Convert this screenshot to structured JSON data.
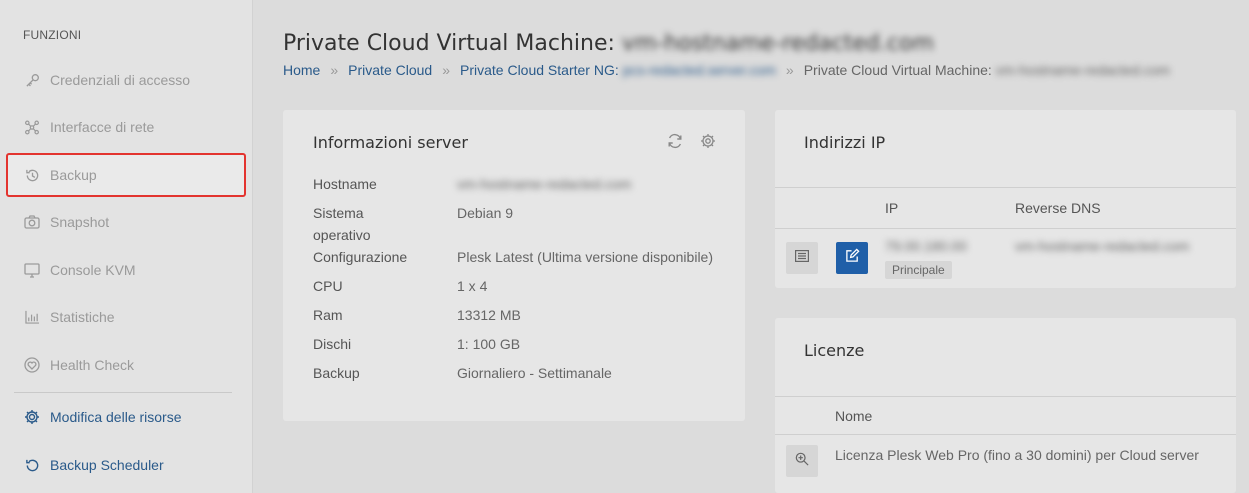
{
  "sidebar": {
    "heading": "FUNZIONI",
    "items": [
      {
        "label": "Credenziali di accesso",
        "icon": "key-icon"
      },
      {
        "label": "Interfacce di rete",
        "icon": "network-icon"
      },
      {
        "label": "Backup",
        "icon": "history-icon"
      },
      {
        "label": "Snapshot",
        "icon": "camera-icon"
      },
      {
        "label": "Console KVM",
        "icon": "monitor-icon"
      },
      {
        "label": "Statistiche",
        "icon": "bar-chart-icon"
      },
      {
        "label": "Health Check",
        "icon": "heart-icon"
      }
    ],
    "links": [
      {
        "label": "Modifica delle risorse",
        "icon": "gear-icon"
      },
      {
        "label": "Backup Scheduler",
        "icon": "history-icon"
      }
    ],
    "accent_color": "#e3342f",
    "link_color": "#2a5a8a"
  },
  "header": {
    "title_prefix": "Private Cloud Virtual Machine:",
    "title_hidden": "vm-hostname-redacted.com"
  },
  "breadcrumb": {
    "home": "Home",
    "private_cloud": "Private Cloud",
    "starter": "Private Cloud Starter NG:",
    "starter_hidden": "pcs-redacted.server.com",
    "current": "Private Cloud Virtual Machine:",
    "current_hidden": "vm-hostname-redacted.com"
  },
  "server_info": {
    "title": "Informazioni server",
    "rows": [
      {
        "label": "Hostname",
        "value": "vm-hostname-redacted.com"
      },
      {
        "label": "Sistema operativo",
        "value": "Debian 9"
      },
      {
        "label": "Configurazione",
        "value": "Plesk Latest (Ultima versione disponibile)"
      },
      {
        "label": "CPU",
        "value": "1 x 4"
      },
      {
        "label": "Ram",
        "value": "13312 MB"
      },
      {
        "label": "Dischi",
        "value": "1: 100 GB"
      },
      {
        "label": "Backup",
        "value": "Giornaliero - Settimanale"
      }
    ]
  },
  "ip_panel": {
    "title": "Indirizzi IP",
    "col_ip": "IP",
    "col_dns": "Reverse DNS",
    "row": {
      "ip": "79.00.180.00",
      "dns": "vm-hostname-redacted.com",
      "badge": "Principale"
    },
    "edit_color": "#1f5fa8"
  },
  "licenses": {
    "title": "Licenze",
    "col_name": "Nome",
    "row": {
      "name": "Licenza Plesk Web Pro (fino a 30 domini) per Cloud server"
    }
  }
}
